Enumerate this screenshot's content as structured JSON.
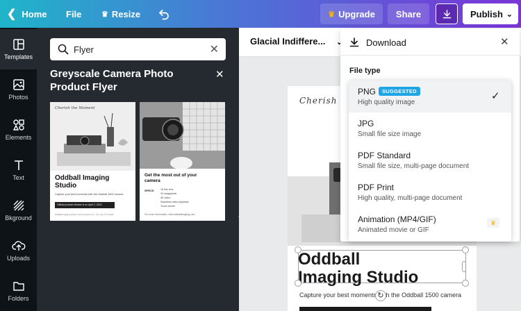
{
  "topbar": {
    "home": "Home",
    "file": "File",
    "resize": "Resize",
    "upgrade": "Upgrade",
    "share": "Share",
    "publish": "Publish",
    "accent": "#7b34d8"
  },
  "rail": {
    "items": [
      {
        "label": "Templates",
        "icon": "templates-icon"
      },
      {
        "label": "Photos",
        "icon": "photos-icon"
      },
      {
        "label": "Elements",
        "icon": "elements-icon"
      },
      {
        "label": "Text",
        "icon": "text-icon"
      },
      {
        "label": "Bkground",
        "icon": "background-icon"
      },
      {
        "label": "Uploads",
        "icon": "uploads-icon"
      },
      {
        "label": "Folders",
        "icon": "folders-icon"
      }
    ]
  },
  "panel": {
    "search_value": "Flyer",
    "title": "Greyscale Camera Photo Product Flyer",
    "thumb1": {
      "script": "Cherish the Moment",
      "title": "Oddball Imaging Studio",
      "tagline": "Capture your best moments with the Oddball 1500 camera",
      "button": "Official product release is on April 2, 2022",
      "footer": "Oddball Imaging Studio | 123 Anywhere St., Any City, ST 12345"
    },
    "thumb2": {
      "heading": "Get the most out of your camera",
      "specs_label": "SPECS",
      "specs": [
        "16 fine lens",
        "24 megapixels",
        "4K video",
        "Seamless video playback",
        "Touch screen"
      ],
      "footer": "For more information, visit oddballimaging.com"
    }
  },
  "editor": {
    "font": "Glacial Indiffere...",
    "page": {
      "script": "Cherish th",
      "title_line1": "Oddball",
      "title_line2": "Imaging Studio",
      "tagline": "Capture your best moments with the Oddball 1500 camera"
    }
  },
  "download": {
    "title": "Download",
    "file_type_label": "File type",
    "options": [
      {
        "name": "PNG",
        "desc": "High quality image",
        "badge": "SUGGESTED",
        "selected": true
      },
      {
        "name": "JPG",
        "desc": "Small file size image"
      },
      {
        "name": "PDF Standard",
        "desc": "Small file size, multi-page document"
      },
      {
        "name": "PDF Print",
        "desc": "High quality, multi-page document"
      },
      {
        "name": "Animation (MP4/GIF)",
        "desc": "Animated movie or GIF",
        "premium": true
      }
    ]
  }
}
